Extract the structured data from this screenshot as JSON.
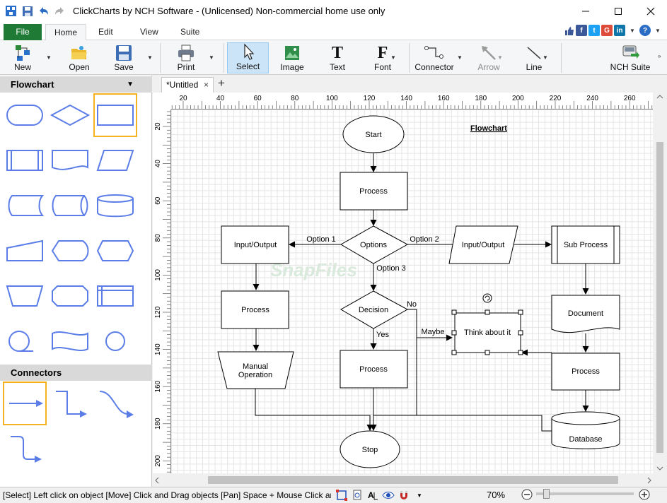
{
  "window": {
    "title": "ClickCharts by NCH Software - (Unlicensed) Non-commercial home use only",
    "controls": [
      "minimize",
      "maximize",
      "close"
    ]
  },
  "ribbon_tabs": [
    "File",
    "Home",
    "Edit",
    "View",
    "Suite"
  ],
  "active_tab": "Home",
  "toolbar": {
    "new": "New",
    "open": "Open",
    "save": "Save",
    "print": "Print",
    "select": "Select",
    "image": "Image",
    "text": "Text",
    "font": "Font",
    "connector": "Connector",
    "arrow": "Arrow",
    "line": "Line",
    "nch_suite": "NCH Suite"
  },
  "left_panel": {
    "shapes_header": "Flowchart",
    "connectors_header": "Connectors"
  },
  "doc_tab": {
    "name": "*Untitled",
    "close": "×",
    "add": "+"
  },
  "ruler": {
    "h_labels": [
      "20",
      "40",
      "60",
      "80",
      "100",
      "120",
      "140",
      "160",
      "180",
      "200",
      "220",
      "240",
      "260"
    ],
    "v_labels": [
      "20",
      "40",
      "60",
      "80",
      "100",
      "120",
      "140",
      "160",
      "180",
      "200"
    ]
  },
  "diagram": {
    "title": "Flowchart",
    "start": "Start",
    "process1": "Process",
    "options": "Options",
    "option1": "Option 1",
    "option2": "Option 2",
    "option3": "Option 3",
    "io_left": "Input/Output",
    "io_right": "Input/Output",
    "sub_process": "Sub Process",
    "process_left": "Process",
    "decision": "Decision",
    "no": "No",
    "yes": "Yes",
    "maybe": "Maybe",
    "think": "Think about it",
    "document": "Document",
    "manual_line1": "Manual",
    "manual_line2": "Operation",
    "process_mid": "Process",
    "process_right": "Process",
    "database": "Database",
    "stop": "Stop",
    "watermark": "SnapFiles"
  },
  "status": {
    "text": "[Select] Left click on object  [Move] Click and Drag objects  [Pan] Space + Mouse Click ar",
    "zoom": "70%",
    "zoom_out": "−",
    "zoom_in": "+"
  },
  "colors": {
    "file_tab": "#1e7a35",
    "shape_stroke": "#5b7de8",
    "selected_border": "#f5b324",
    "select_button_bg": "#cce4f7"
  }
}
